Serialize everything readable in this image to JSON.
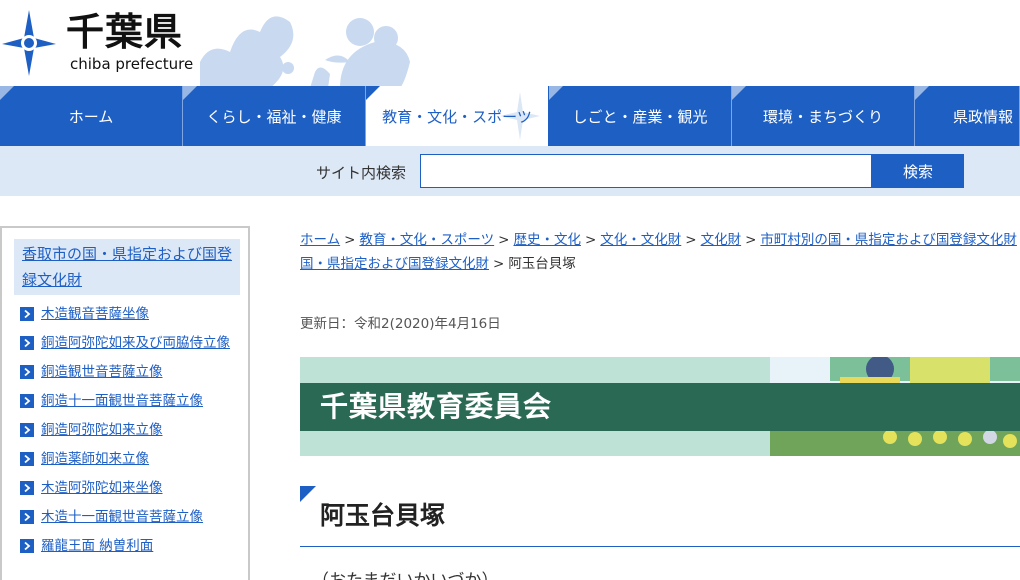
{
  "header": {
    "logo_jp": "千葉県",
    "logo_en": "chiba prefecture"
  },
  "gnav": {
    "items": [
      {
        "label": "ホーム"
      },
      {
        "label": "くらし・福祉・健康"
      },
      {
        "label": "教育・文化・スポーツ",
        "active": true
      },
      {
        "label": "しごと・産業・観光"
      },
      {
        "label": "環境・まちづくり"
      },
      {
        "label": "県政情報"
      }
    ]
  },
  "search": {
    "label": "サイト内検索",
    "value": "",
    "placeholder": "",
    "button_label": "検索"
  },
  "sidebar": {
    "title": "香取市の国・県指定および国登録文化財",
    "items": [
      {
        "label": "木造観音菩薩坐像"
      },
      {
        "label": "銅造阿弥陀如来及び両脇侍立像"
      },
      {
        "label": "銅造観世音菩薩立像"
      },
      {
        "label": "銅造十一面観世音菩薩立像"
      },
      {
        "label": "銅造阿弥陀如来立像"
      },
      {
        "label": "銅造薬師如来立像"
      },
      {
        "label": "木造阿弥陀如来坐像"
      },
      {
        "label": "木造十一面観世音菩薩立像"
      },
      {
        "label": "羅龍王面 納曽利面"
      }
    ]
  },
  "breadcrumb": {
    "links": [
      "ホーム",
      "教育・文化・スポーツ",
      "歴史・文化",
      "文化・文化財",
      "文化財",
      "市町村別の国・県指定および国登録文化財",
      "国・県指定および国登録文化財"
    ],
    "separator": ">",
    "current": "阿玉台貝塚"
  },
  "main": {
    "updated": "更新日：令和2(2020)年4月16日",
    "banner_title": "千葉県教育委員会",
    "page_title": "阿玉台貝塚",
    "reading": "（おたまだいかいづか）"
  },
  "colors": {
    "primary_blue": "#1e5fc4",
    "light_blue": "#dde8f7",
    "banner_green": "#2a6a55",
    "banner_mint": "#bfe2d6"
  }
}
